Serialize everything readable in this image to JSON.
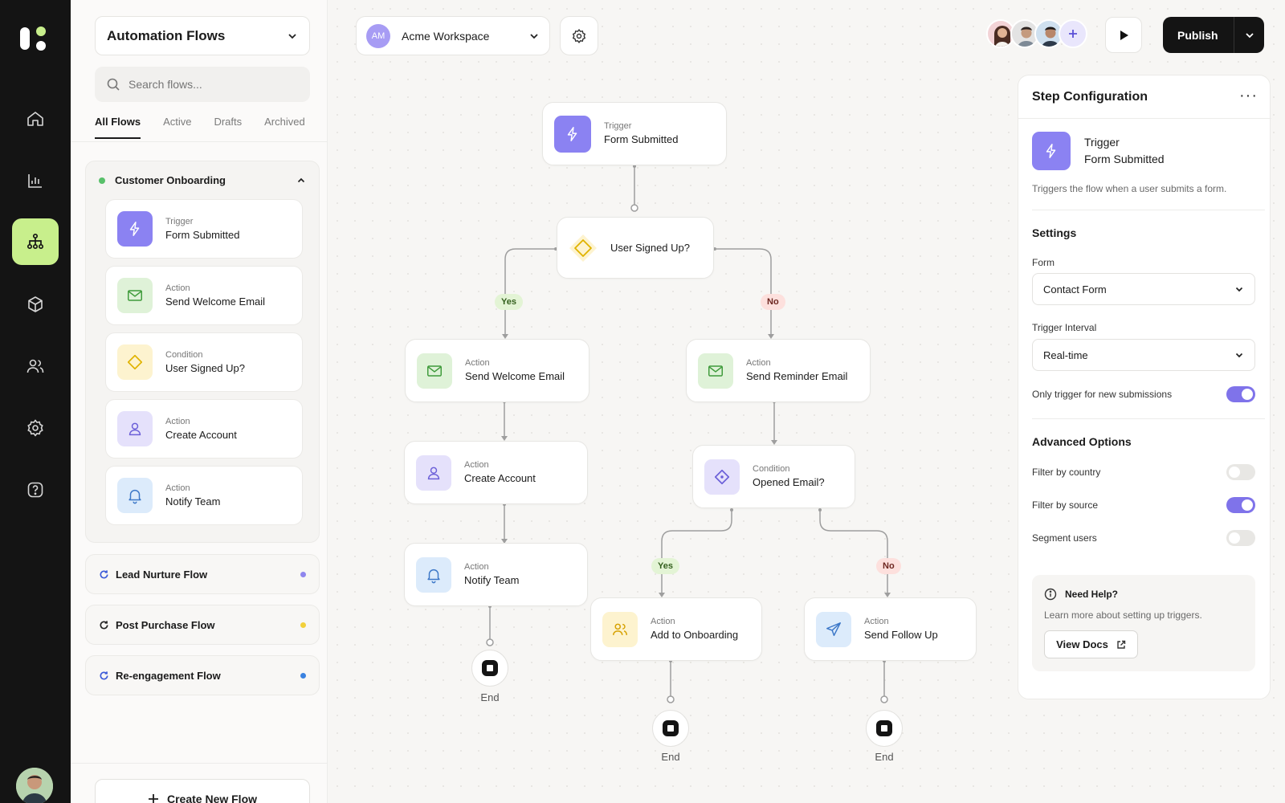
{
  "colors": {
    "rail_bg": "#141414",
    "rail_active": "#c8ef8c",
    "accent_purple": "#7f73ea",
    "yes_badge": "#e3f4d5",
    "no_badge": "#fde0dd",
    "publish_bg": "#141414"
  },
  "rail": {
    "icons": [
      "home-icon",
      "chart-icon",
      "flow-icon",
      "cube-icon",
      "users-icon",
      "gear-icon",
      "help-icon"
    ],
    "active": "flow-icon"
  },
  "sidebar": {
    "flow_selector": "Automation Flows",
    "search_placeholder": "Search flows...",
    "tabs": [
      "All Flows",
      "Active",
      "Drafts",
      "Archived"
    ],
    "active_tab": "All Flows",
    "group": {
      "name": "Customer Onboarding",
      "steps": [
        {
          "kind": "Trigger",
          "label": "Form Submitted",
          "icon": "bolt-icon"
        },
        {
          "kind": "Action",
          "label": "Send Welcome Email",
          "icon": "mail-icon"
        },
        {
          "kind": "Condition",
          "label": "User Signed Up?",
          "icon": "diamond-icon"
        },
        {
          "kind": "Action",
          "label": "Create Account",
          "icon": "user-icon"
        },
        {
          "kind": "Action",
          "label": "Notify Team",
          "icon": "bell-icon"
        }
      ]
    },
    "flows": [
      {
        "name": "Lead Nurture Flow",
        "dot": "#8f86ee"
      },
      {
        "name": "Post Purchase Flow",
        "dot": "#f2d03b"
      },
      {
        "name": "Re-engagement Flow",
        "dot": "#3b82e0"
      }
    ],
    "create_button": "Create New Flow"
  },
  "topbar": {
    "workspace_initials": "AM",
    "workspace": "Acme Workspace",
    "publish": "Publish"
  },
  "canvas": {
    "trigger": {
      "kind": "Trigger",
      "label": "Form Submitted"
    },
    "condition1": {
      "label": "User Signed Up?"
    },
    "yes": "Yes",
    "no": "No",
    "welcome": {
      "kind": "Action",
      "label": "Send Welcome Email"
    },
    "reminder": {
      "kind": "Action",
      "label": "Send Reminder Email"
    },
    "create_account": {
      "kind": "Action",
      "label": "Create Account"
    },
    "opened": {
      "kind": "Condition",
      "label": "Opened Email?"
    },
    "notify": {
      "kind": "Action",
      "label": "Notify Team"
    },
    "onboarding": {
      "kind": "Action",
      "label": "Add to Onboarding"
    },
    "followup": {
      "kind": "Action",
      "label": "Send Follow Up"
    },
    "end": "End"
  },
  "panel": {
    "title": "Step Configuration",
    "trigger_kind": "Trigger",
    "trigger_label": "Form Submitted",
    "description": "Triggers the flow when a user submits a form.",
    "settings_heading": "Settings",
    "form_label": "Form",
    "form_value": "Contact Form",
    "interval_label": "Trigger Interval",
    "interval_value": "Real-time",
    "new_only_label": "Only trigger for new submissions",
    "new_only": true,
    "advanced_heading": "Advanced Options",
    "options": [
      {
        "label": "Filter by country",
        "on": false
      },
      {
        "label": "Filter by source",
        "on": true
      },
      {
        "label": "Segment users",
        "on": false
      }
    ],
    "help_title": "Need Help?",
    "help_text": "Learn more about setting up triggers.",
    "help_button": "View Docs"
  }
}
